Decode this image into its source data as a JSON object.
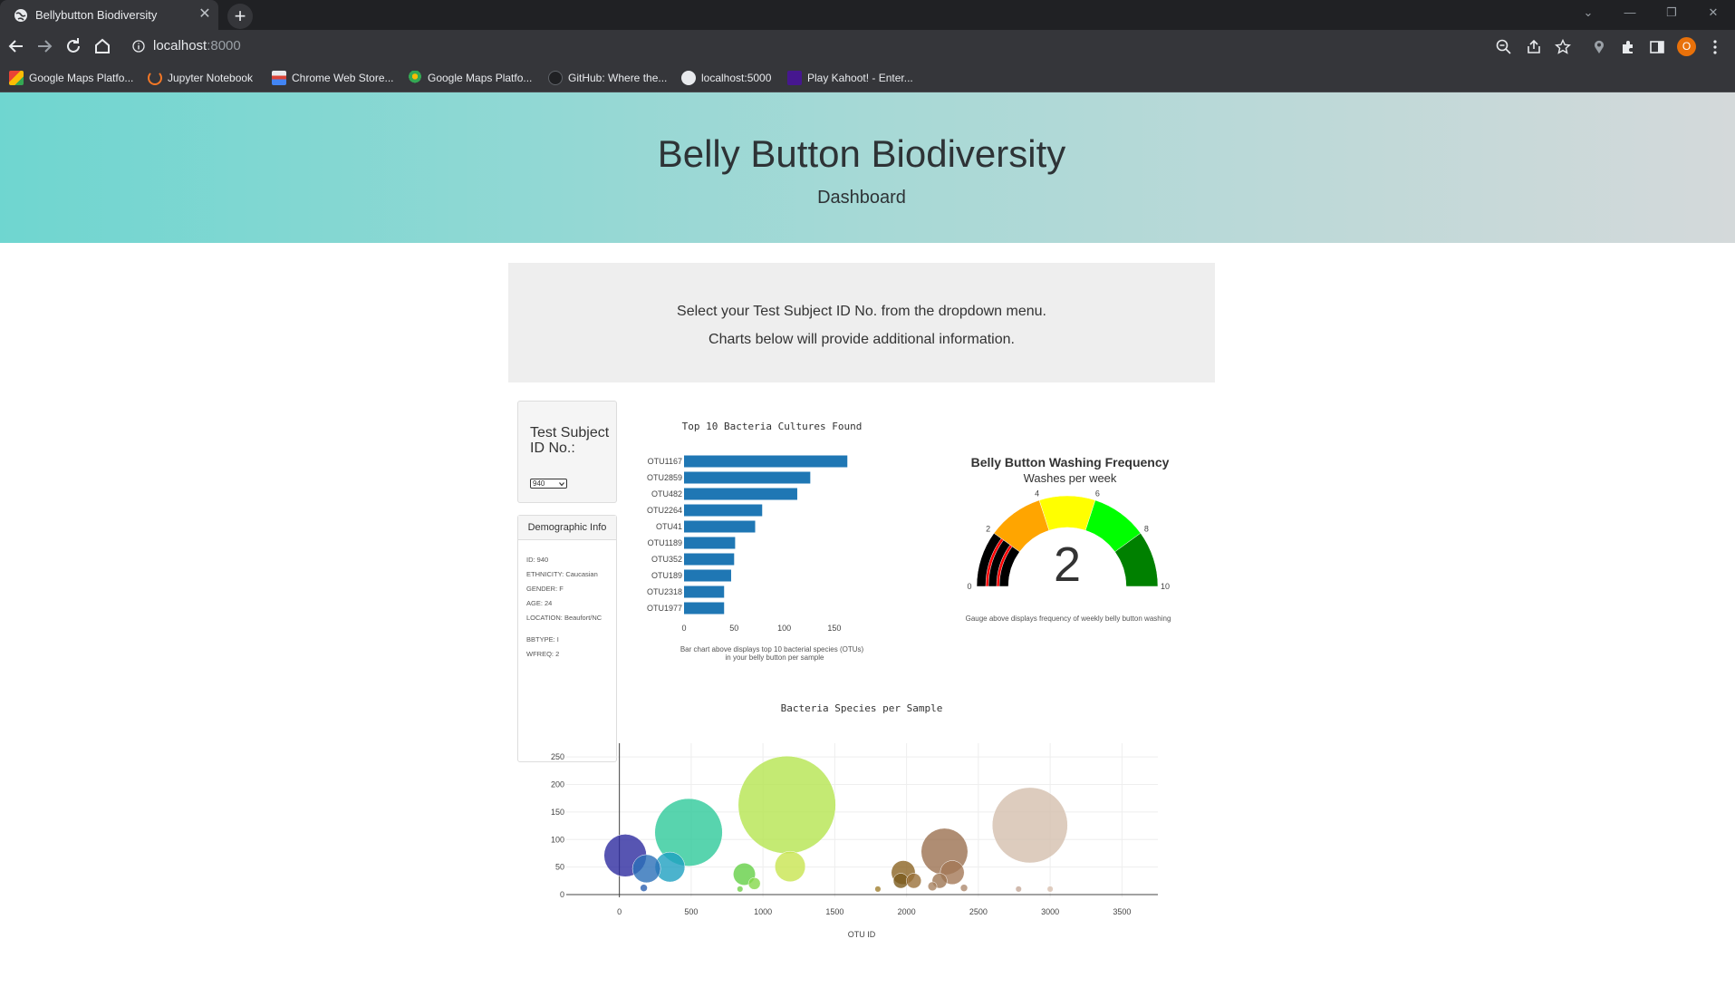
{
  "browser": {
    "tab_title": "Bellybutton Biodiversity",
    "tab_close": "✕",
    "new_tab": "+",
    "url_host": "localhost",
    "url_port": ":8000",
    "profile_initial": "O",
    "bookmarks": [
      {
        "label": "Google Maps Platfo...",
        "icon": "map-bookmark-icon"
      },
      {
        "label": "Jupyter Notebook",
        "icon": "jupyter-icon"
      },
      {
        "label": "Chrome Web Store...",
        "icon": "web-store-icon"
      },
      {
        "label": "Google Maps Platfo...",
        "icon": "maps-pin-icon"
      },
      {
        "label": "GitHub: Where the...",
        "icon": "github-icon"
      },
      {
        "label": "localhost:5000",
        "icon": "globe-icon"
      },
      {
        "label": "Play Kahoot! - Enter...",
        "icon": "kahoot-icon"
      }
    ]
  },
  "hero": {
    "title": "Belly Button Biodiversity",
    "subtitle": "Dashboard"
  },
  "intro": {
    "line1": "Select your Test Subject ID No. from the dropdown menu.",
    "line2": "Charts below will provide additional information."
  },
  "selector": {
    "label": "Test Subject ID No.:",
    "selected": "940"
  },
  "demographics": {
    "heading": "Demographic Info",
    "rows": [
      "ID: 940",
      "ETHNICITY: Caucasian",
      "GENDER: F",
      "AGE: 24",
      "LOCATION: Beaufort/NC",
      "BBTYPE: I",
      "WFREQ: 2"
    ]
  },
  "colors": {
    "bar": "#1f77b4",
    "hero_start": "#6fd6d0",
    "hero_end": "#d4d9da",
    "gauge": [
      "#000000",
      "#ffa500",
      "#ffff00",
      "#00ff00",
      "#008000"
    ]
  },
  "chart_data": [
    {
      "type": "bar",
      "orientation": "horizontal",
      "title": "Top 10 Bacteria Cultures Found",
      "categories": [
        "OTU1167",
        "OTU2859",
        "OTU482",
        "OTU2264",
        "OTU41",
        "OTU1189",
        "OTU352",
        "OTU189",
        "OTU2318",
        "OTU1977"
      ],
      "values": [
        163,
        126,
        113,
        78,
        71,
        51,
        50,
        47,
        40,
        40
      ],
      "xticks": [
        0,
        50,
        100,
        150
      ],
      "xlim": [
        0,
        170
      ],
      "caption_line1": "Bar chart above displays top 10 bacterial species (OTUs)",
      "caption_line2": "in your belly button per sample"
    },
    {
      "type": "gauge",
      "title": "Belly Button Washing Frequency",
      "subtitle": "Washes per week",
      "value": 2,
      "range": [
        0,
        10
      ],
      "ticks": [
        0,
        2,
        4,
        6,
        8,
        10
      ],
      "steps": [
        {
          "range": [
            0,
            2
          ],
          "color": "#000000"
        },
        {
          "range": [
            2,
            4
          ],
          "color": "#ffa500"
        },
        {
          "range": [
            4,
            6
          ],
          "color": "#ffff00"
        },
        {
          "range": [
            6,
            8
          ],
          "color": "#00ff00"
        },
        {
          "range": [
            8,
            10
          ],
          "color": "#008000"
        }
      ],
      "bar_color": "#ff0000",
      "caption": "Gauge above displays frequency of weekly belly button washing"
    },
    {
      "type": "scatter",
      "mode": "bubble",
      "title": "Bacteria Species per Sample",
      "xlabel": "OTU ID",
      "xticks": [
        0,
        500,
        1000,
        1500,
        2000,
        2500,
        3000,
        3500
      ],
      "yticks": [
        0,
        50,
        100,
        150,
        200,
        250
      ],
      "xlim": [
        -370,
        3750
      ],
      "ylim": [
        -5,
        275
      ],
      "grid": true,
      "points": [
        {
          "x": 41,
          "y": 71,
          "color": "#2d2a9f"
        },
        {
          "x": 189,
          "y": 47,
          "color": "#2a6fb8"
        },
        {
          "x": 352,
          "y": 50,
          "color": "#1ea0c0"
        },
        {
          "x": 482,
          "y": 113,
          "color": "#2ec99a"
        },
        {
          "x": 1167,
          "y": 163,
          "color": "#b5e550"
        },
        {
          "x": 1189,
          "y": 51,
          "color": "#c8e550"
        },
        {
          "x": 870,
          "y": 37,
          "color": "#64d046"
        },
        {
          "x": 940,
          "y": 20,
          "color": "#84d84a"
        },
        {
          "x": 1977,
          "y": 40,
          "color": "#8b6423"
        },
        {
          "x": 1960,
          "y": 25,
          "color": "#7a5a1c"
        },
        {
          "x": 2050,
          "y": 25,
          "color": "#9a7038"
        },
        {
          "x": 2264,
          "y": 78,
          "color": "#9b7050"
        },
        {
          "x": 2318,
          "y": 40,
          "color": "#a47856"
        },
        {
          "x": 2230,
          "y": 25,
          "color": "#9e7652"
        },
        {
          "x": 2180,
          "y": 15,
          "color": "#a88260"
        },
        {
          "x": 2859,
          "y": 126,
          "color": "#d4bfae"
        },
        {
          "x": 2780,
          "y": 10,
          "color": "#c4a898"
        },
        {
          "x": 3000,
          "y": 10,
          "color": "#d8c0b0"
        },
        {
          "x": 1800,
          "y": 10,
          "color": "#a08030"
        },
        {
          "x": 170,
          "y": 12,
          "color": "#2a5fb0"
        },
        {
          "x": 840,
          "y": 10,
          "color": "#70d04a"
        },
        {
          "x": 2400,
          "y": 12,
          "color": "#ae8a6e"
        }
      ]
    }
  ]
}
